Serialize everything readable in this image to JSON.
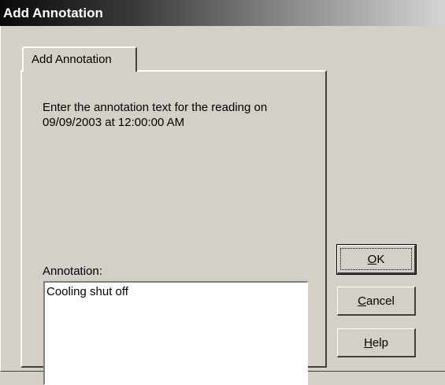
{
  "window": {
    "title": "Add Annotation"
  },
  "tabs": [
    {
      "label": "Add Annotation",
      "selected": true
    }
  ],
  "panel": {
    "instructions": "Enter the annotation text for the reading on 09/09/2003 at 12:00:00 AM",
    "annotation_label": "Annotation:",
    "annotation_value": "Cooling shut off"
  },
  "buttons": {
    "ok": {
      "mnemonic": "O",
      "rest": "K"
    },
    "cancel": {
      "mnemonic": "C",
      "rest": "ancel"
    },
    "help": {
      "mnemonic": "H",
      "rest": "elp"
    }
  }
}
